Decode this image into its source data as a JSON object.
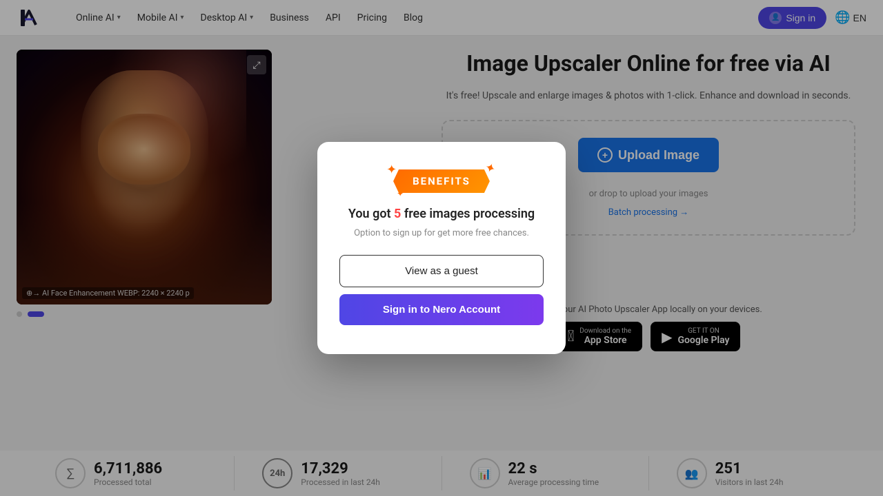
{
  "navbar": {
    "logo_alt": "AI Logo",
    "nav_items": [
      {
        "label": "Online AI",
        "has_dropdown": true
      },
      {
        "label": "Mobile AI",
        "has_dropdown": true
      },
      {
        "label": "Desktop AI",
        "has_dropdown": true
      },
      {
        "label": "Business",
        "has_dropdown": false
      },
      {
        "label": "API",
        "has_dropdown": false
      },
      {
        "label": "Pricing",
        "has_dropdown": false
      },
      {
        "label": "Blog",
        "has_dropdown": false
      }
    ],
    "signin_label": "Sign in",
    "lang": "EN"
  },
  "hero": {
    "title": "Image Upscaler Online for free via AI",
    "subtitle": "It's free! Upscale and enlarge images & photos with 1-click. Enhance and download in seconds.",
    "upload_button": "Upload Image",
    "drop_text": "or drop to upload your images",
    "batch_link": "Batch processing →"
  },
  "image_preview": {
    "label": "⊕→ AI Face Enhancement WEBP: 2240 × 2240 p"
  },
  "app_section": {
    "text": "Or use our AI Photo Upscaler App locally on your devices.",
    "appstore": {
      "small": "Download on the",
      "large": "App Store"
    },
    "googleplay": {
      "small": "GET IT ON",
      "large": "Google Play"
    }
  },
  "stats": [
    {
      "num": "6,711,886",
      "label": "Processed total",
      "icon": "sigma"
    },
    {
      "num": "17,329",
      "label": "Processed in last 24h",
      "icon": "clock24"
    },
    {
      "num": "22 s",
      "label": "Average processing time",
      "icon": "bars"
    },
    {
      "num": "251",
      "label": "Visitors in last 24h",
      "icon": "people"
    }
  ],
  "modal": {
    "badge_text": "BENEFITS",
    "title_prefix": "You got ",
    "title_count": "5",
    "title_suffix": " free images processing",
    "subtitle": "Option to sign up for get more free chances.",
    "guest_btn": "View as a guest",
    "signin_btn": "Sign in to Nero Account"
  },
  "dots": [
    {
      "active": false
    },
    {
      "active": true
    }
  ]
}
